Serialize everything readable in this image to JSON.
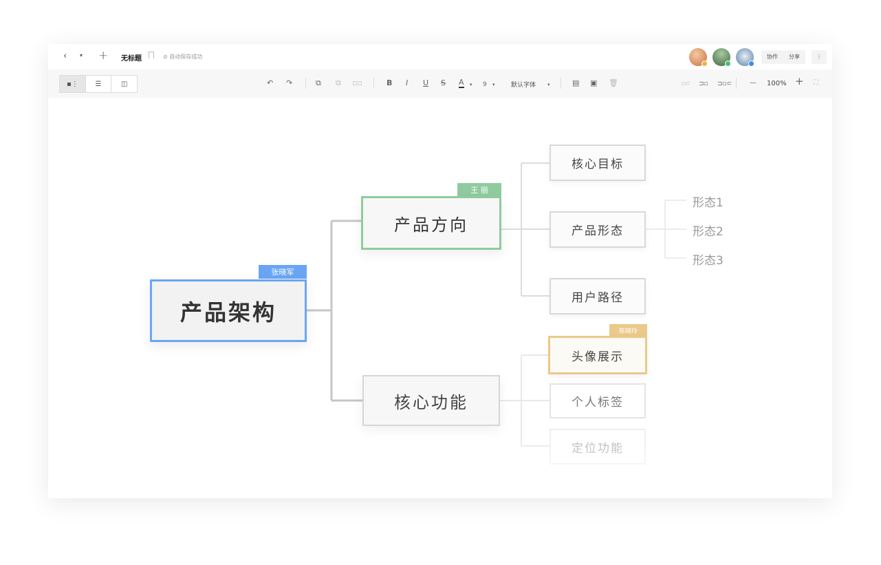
{
  "topbar": {
    "back_icon": "‹",
    "dropdown_icon": "▾",
    "add_icon": "+",
    "title": "无标题",
    "save_status": "⊘ 自动保存成功",
    "collaborate_label": "协作",
    "share_label": "分享",
    "more_icon": "⋮"
  },
  "toolbar": {
    "undo_icon": "↶",
    "redo_icon": "↷",
    "bold": "B",
    "italic": "I",
    "underline": "U",
    "strike": "S",
    "font_color": "A",
    "font_size": "9",
    "font_family": "默认字体",
    "zoom_out": "—",
    "zoom_level": "100%",
    "zoom_in": "+",
    "fullscreen_icon": "⛶"
  },
  "mindmap": {
    "root": "产品架构",
    "branch1": "产品方向",
    "branch2": "核心功能",
    "children1": [
      "核心目标",
      "产品形态",
      "用户路径"
    ],
    "children2": [
      "头像展示",
      "个人标签",
      "定位功能"
    ],
    "leaves": [
      "形态1",
      "形态2",
      "形态3"
    ]
  },
  "cursors": {
    "root_user": "张晓军",
    "branch1_user": "王 丽",
    "child_user": "陈晓玲"
  },
  "colors": {
    "blue": "#6aa5f4",
    "green": "#8fcb9e",
    "gold": "#ebc98a"
  }
}
